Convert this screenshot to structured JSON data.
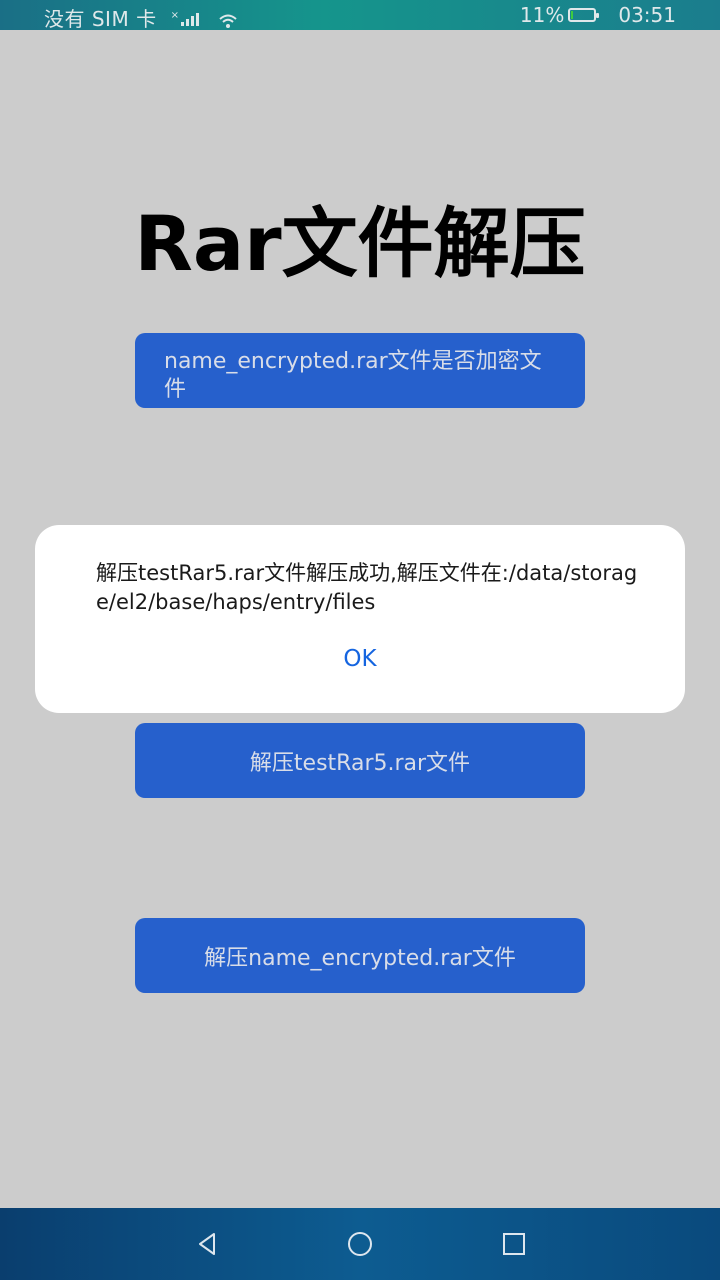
{
  "status_bar": {
    "carrier": "没有 SIM 卡",
    "battery_percent": "11%",
    "battery_level": 0.11,
    "time": "03:51",
    "colors": {
      "battery_fill": "#3ecb3e"
    }
  },
  "page": {
    "title": "Rar文件解压",
    "background": "#cccccc"
  },
  "buttons": {
    "check_encrypted": "name_encrypted.rar文件是否加密文件",
    "extract_test": "解压testRar5.rar文件",
    "extract_encrypted": "解压name_encrypted.rar文件",
    "color": "#2660cc"
  },
  "dialog": {
    "message": "解压testRar5.rar文件解压成功,解压文件在:/data/storage/el2/base/haps/entry/files",
    "ok_label": "OK",
    "ok_color": "#1565e0"
  },
  "nav_bar": {
    "icons": [
      "back-triangle-icon",
      "home-circle-icon",
      "recent-square-icon"
    ]
  }
}
